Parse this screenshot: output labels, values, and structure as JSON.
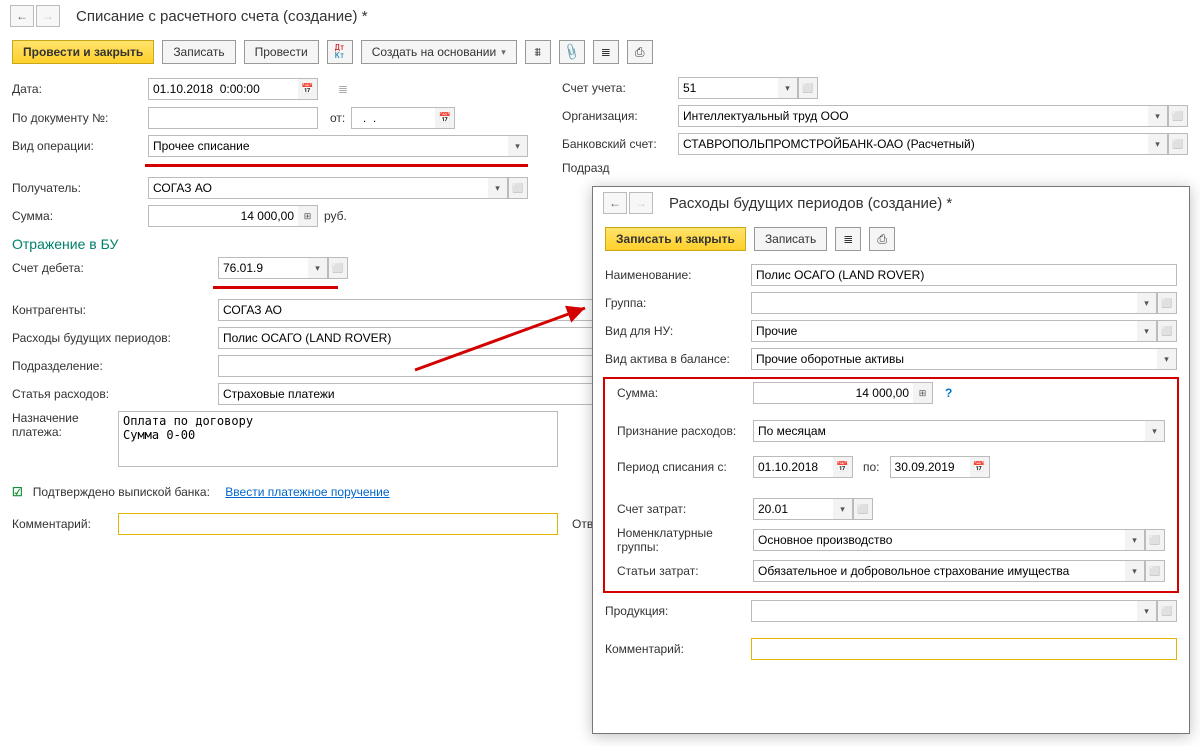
{
  "win1": {
    "title": "Списание с расчетного счета (создание) *",
    "toolbar": {
      "post_close": "Провести и закрыть",
      "save": "Записать",
      "post": "Провести",
      "create_from": "Создать на основании"
    },
    "labels": {
      "date": "Дата:",
      "doc_num": "По документу №:",
      "ot": "от:",
      "op_type": "Вид операции:",
      "recipient": "Получатель:",
      "sum": "Сумма:",
      "currency": "руб.",
      "account": "Счет учета:",
      "org": "Организация:",
      "bank_acc": "Банковский счет:",
      "podrazd": "Подразд",
      "section": "Отражение в БУ",
      "debit_acc": "Счет дебета:",
      "contragent": "Контрагенты:",
      "rbp": "Расходы будущих периодов:",
      "dept": "Подразделение:",
      "exp_item": "Статья расходов:",
      "purpose": "Назначение платежа:",
      "confirmed": "Подтверждено выпиской банка:",
      "link": "Ввести платежное поручение",
      "comment": "Комментарий:",
      "resp": "Ответстве"
    },
    "values": {
      "date": "01.10.2018  0:00:00",
      "op_type": "Прочее списание",
      "recipient": "СОГАЗ АО",
      "sum": "14 000,00",
      "account": "51",
      "org": "Интеллектуальный труд ООО",
      "bank_acc": "СТАВРОПОЛЬПРОМСТРОЙБАНК-ОАО (Расчетный)",
      "debit_acc": "76.01.9",
      "contragent": "СОГАЗ АО",
      "rbp": "Полис ОСАГО (LAND ROVER)",
      "exp_item": "Страховые платежи",
      "purpose": "Оплата по договору\nСумма 0-00"
    }
  },
  "win2": {
    "title": "Расходы будущих периодов (создание) *",
    "toolbar": {
      "save_close": "Записать и закрыть",
      "save": "Записать"
    },
    "labels": {
      "name": "Наименование:",
      "group": "Группа:",
      "nu_type": "Вид для НУ:",
      "asset_type": "Вид актива в балансе:",
      "sum": "Сумма:",
      "recognition": "Признание расходов:",
      "period_from": "Период списания с:",
      "period_to": "по:",
      "cost_acc": "Счет затрат:",
      "nom_group": "Номенклатурные группы:",
      "cost_items": "Статьи затрат:",
      "product": "Продукция:",
      "comment": "Комментарий:"
    },
    "values": {
      "name": "Полис ОСАГО (LAND ROVER)",
      "nu_type": "Прочие",
      "asset_type": "Прочие оборотные активы",
      "sum": "14 000,00",
      "recognition": "По месяцам",
      "period_from": "01.10.2018",
      "period_to": "30.09.2019",
      "cost_acc": "20.01",
      "nom_group": "Основное производство",
      "cost_items": "Обязательное и добровольное страхование имущества"
    }
  }
}
